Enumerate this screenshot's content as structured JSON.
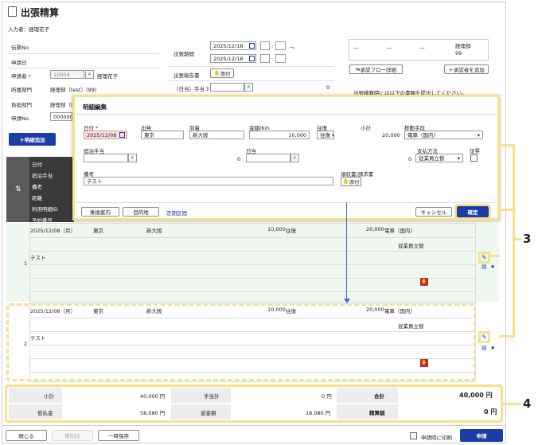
{
  "page": {
    "title": "出張精算",
    "input_user": "入力者：経理花子"
  },
  "form": {
    "doc_no_label": "伝票No.",
    "apply_date_label": "申請日",
    "applicant_label": "申請者",
    "applicant_code": "10004",
    "applicant_name": "経理花子",
    "dept_label": "所属部門",
    "dept_value": "経理部（test）(99)",
    "cost_dept_label": "負担部門",
    "cost_dept_value": "経理部（t",
    "apply_no_label": "申請No.",
    "apply_no_value": "000000",
    "trip_period_label": "出張期間",
    "date_from": "2025/12/18",
    "date_to": "2025/12/18",
    "tilde": "～",
    "colon": ":",
    "report_label": "出張報告書",
    "attach_label": "添付",
    "allowance_label": "（日当）手当３",
    "allowance_value": "0"
  },
  "approval": {
    "cols": [
      "―",
      "―",
      "―",
      "経理部\n99"
    ],
    "flow_btn": "承認フロー詳細",
    "add_btn": "承認者を追加",
    "notice": "出張精算時には以下の書類を提出してください。"
  },
  "add_line_btn": "明細追加",
  "left_headers": [
    "日付",
    "宿泊手当",
    "備考",
    "距離",
    "利用明細ID",
    "予約番号"
  ],
  "modal": {
    "title": "明細編集",
    "date_label": "日付",
    "date_value": "2025/12/08",
    "from_label": "出発",
    "from_value": "東京",
    "to_label": "到着",
    "to_value": "新大阪",
    "amount_label": "金額/Km",
    "amount_value": "10,000",
    "roundtrip_label": "往復",
    "roundtrip_value": "往復",
    "subtotal_label": "小計",
    "subtotal_value": "20,000",
    "transport_label": "移動手段",
    "transport_value": "電車（国内）",
    "lodging_label": "宿泊手当",
    "lodging_value": "0",
    "daily_label": "日当",
    "daily_value": "0",
    "pay_label": "支払方法",
    "pay_value": "従業員立替",
    "receipt_label": "証票",
    "memo_label": "備考",
    "memo_value": "テスト",
    "invoice_label": "領収書/請求書",
    "attach_label": "添付",
    "btn_transfer": "乗換案内",
    "btn_dest": "目的地",
    "link_commuter": "定期区間",
    "btn_cancel": "キャンセル",
    "btn_confirm": "確定"
  },
  "rows": [
    {
      "no": "1",
      "date": "2025/12/08（月）",
      "from": "東京",
      "to": "新大阪",
      "amount": "10,000",
      "trip": "往復",
      "subtotal": "20,000",
      "transport": "電車（国内）",
      "pay": "従業員立替",
      "memo": "テスト"
    },
    {
      "no": "2",
      "date": "2025/12/08（月）",
      "from": "東京",
      "to": "新大阪",
      "amount": "10,000",
      "trip": "往復",
      "subtotal": "20,000",
      "transport": "電車（国内）",
      "pay": "従業員立替",
      "memo": "テスト"
    }
  ],
  "totals": {
    "subtotal_label": "小計",
    "subtotal_value": "40,000 円",
    "allow_label": "手当計",
    "allow_value": "0 円",
    "total_label": "合計",
    "total_value": "40,000 円",
    "advance_label": "仮払金",
    "advance_value": "58,080 円",
    "refund_label": "返金額",
    "refund_value": "18,080 円",
    "settle_label": "精算額",
    "settle_value": "0 円"
  },
  "footer": {
    "close": "閉じる",
    "delete": "削除",
    "save": "一時保存",
    "print_label": "申請時に印刷",
    "apply": "申請"
  },
  "callouts": {
    "c3": "3",
    "c4": "4"
  },
  "colors": {
    "accent": "#1a3da8",
    "highlight": "#f7e08a",
    "required": "#d00",
    "green_row": "#eef8f0"
  }
}
